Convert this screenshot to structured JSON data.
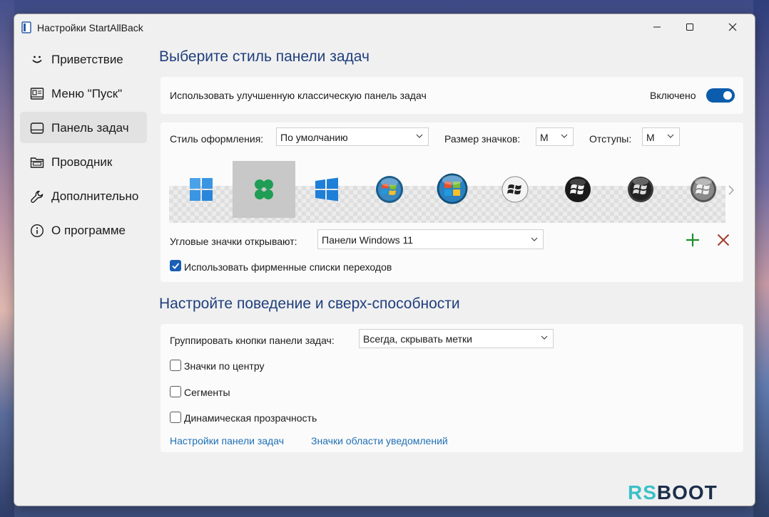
{
  "window": {
    "title": "Настройки StartAllBack"
  },
  "sidebar": {
    "items": [
      {
        "label": "Приветствие",
        "icon": "smile-icon",
        "active": false
      },
      {
        "label": "Меню \"Пуск\"",
        "icon": "start-menu-icon",
        "active": false
      },
      {
        "label": "Панель задач",
        "icon": "taskbar-icon",
        "active": true
      },
      {
        "label": "Проводник",
        "icon": "file-explorer-icon",
        "active": false
      },
      {
        "label": "Дополнительно",
        "icon": "wrench-icon",
        "active": false
      },
      {
        "label": "О программе",
        "icon": "info-icon",
        "active": false
      }
    ]
  },
  "taskbar_style": {
    "heading": "Выберите стиль панели задач",
    "enhanced_label": "Использовать улучшенную классическую панель задач",
    "toggle_state": "Включено",
    "toggle_on": true,
    "theme_label": "Стиль оформления:",
    "theme_value": "По умолчанию",
    "icon_size_label": "Размер значков:",
    "icon_size_value": "M",
    "padding_label": "Отступы:",
    "padding_value": "M",
    "selected_style": "clover-start-icon",
    "styles": [
      "windows-11-start-icon",
      "clover-start-icon",
      "windows-10-start-icon",
      "windows-7-orb-icon",
      "windows-vista-orb-icon",
      "white-orb-icon",
      "black-orb-icon",
      "dark-orb-icon",
      "silver-orb-icon"
    ],
    "corner_label": "Угловые значки открывают:",
    "corner_value": "Панели Windows 11",
    "jumplists_label": "Использовать фирменные списки переходов",
    "jumplists_checked": true
  },
  "behavior": {
    "heading": "Настройте поведение и сверх-способности",
    "group_label": "Группировать кнопки панели задач:",
    "group_value": "Всегда, скрывать метки",
    "center_label": "Значки по центру",
    "center_checked": false,
    "segments_label": "Сегменты",
    "segments_checked": false,
    "transparency_label": "Динамическая прозрачность",
    "transparency_checked": false,
    "link_taskbar": "Настройки панели задач",
    "link_tray": "Значки области уведомлений"
  },
  "colors": {
    "accent": "#0b5cad",
    "heading": "#1f3f7d",
    "link": "#1f6fb5",
    "add": "#1e8f2a",
    "remove": "#a0392b"
  },
  "watermark": {
    "part1": "RS",
    "part2": "BOOT"
  }
}
